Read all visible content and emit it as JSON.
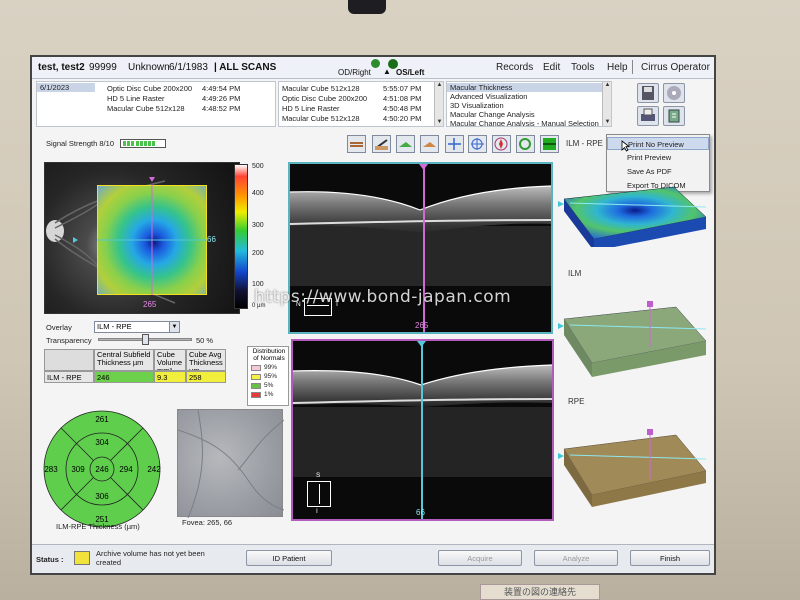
{
  "patient": {
    "name": "test, test2",
    "id": "99999",
    "sex": "Unknown",
    "dob": "6/1/1983",
    "mode": "| ALL SCANS"
  },
  "eye_selector": {
    "od_label": "OD/Right",
    "os_label": "OS/Left",
    "od_color": "#2e8b2e",
    "os_color": "#1a6e1a"
  },
  "menu": {
    "records": "Records",
    "edit": "Edit",
    "tools": "Tools",
    "help": "Help",
    "operator": "Cirrus Operator"
  },
  "scan_list": {
    "date": "6/1/2023",
    "col1": [
      {
        "name": "Optic Disc Cube 200x200",
        "time": "4:49:54 PM"
      },
      {
        "name": "HD 5 Line Raster",
        "time": "4:49:26 PM"
      },
      {
        "name": "Macular Cube 512x128",
        "time": "4:48:52 PM"
      }
    ],
    "col2": [
      {
        "name": "Macular Cube 512x128",
        "time": "5:55:07 PM"
      },
      {
        "name": "Optic Disc Cube 200x200",
        "time": "4:51:08 PM"
      },
      {
        "name": "HD 5 Line Raster",
        "time": "4:50:48 PM"
      },
      {
        "name": "Macular Cube 512x128",
        "time": "4:50:20 PM"
      }
    ],
    "analyses": [
      "Macular Thickness",
      "Advanced Visualization",
      "3D Visualization",
      "Macular Change Analysis",
      "Macular Change Analysis - Manual Selection"
    ]
  },
  "signal": {
    "label": "Signal Strength",
    "value": "8/10",
    "level": 0.8
  },
  "icons": {
    "save": "save-icon",
    "disc": "cd-icon",
    "print": "printer-icon",
    "export": "export-icon",
    "tools": [
      "layer-tool-icon",
      "edit-tool-icon",
      "green-layer-icon",
      "orange-layer-icon",
      "crosshair-icon",
      "target-icon",
      "compass-icon",
      "refresh-icon",
      "gradient-icon"
    ]
  },
  "colorbar": {
    "labels": [
      "500",
      "400",
      "300",
      "200",
      "100",
      "0 µm"
    ]
  },
  "fundus": {
    "h_marker": "66",
    "v_marker": "265"
  },
  "bscan_top": {
    "label": "265",
    "n": "N",
    "t": "T"
  },
  "bscan_bot": {
    "label": "66",
    "s": "S",
    "i": "I"
  },
  "context_menu": {
    "items": [
      "Print No Preview",
      "Print Preview",
      "Save As PDF",
      "Export To DICOM"
    ],
    "highlight_index": 0
  },
  "right_panel": {
    "ilm_rpe": "ILM - RPE",
    "ilm": "ILM",
    "rpe": "RPE"
  },
  "overlay": {
    "label": "Overlay",
    "value": "ILM - RPE"
  },
  "transparency": {
    "label": "Transparency",
    "value": "50 %",
    "level": 0.5
  },
  "thickness_table": {
    "headers": [
      "Central Subfield Thickness µm",
      "Cube Volume mm³",
      "Cube Avg Thickness µm"
    ],
    "row_label": "ILM - RPE",
    "values": [
      "246",
      "9.3",
      "258"
    ],
    "value_colors": [
      "#6dd04b",
      "#f2ef3c",
      "#f2ef3c"
    ]
  },
  "normals": {
    "title": "Distribution of Normals",
    "items": [
      {
        "label": "99%",
        "color": "#f7c8d8"
      },
      {
        "label": "95%",
        "color": "#f5f04a"
      },
      {
        "label": "5%",
        "color": "#6cc04a"
      },
      {
        "label": "1%",
        "color": "#e43c3c"
      }
    ]
  },
  "etdrs": {
    "center": "246",
    "inner": {
      "top": "304",
      "right": "294",
      "bottom": "306",
      "left": "309"
    },
    "outer": {
      "top": "261",
      "right": "242",
      "bottom": "251",
      "left": "283"
    },
    "caption": "ILM-RPE Thickness (µm)",
    "fill": "#5fce4d"
  },
  "fovea": {
    "caption": "Fovea:  265, 66"
  },
  "status": {
    "label": "Status :",
    "message": "Archive volume has not yet been created",
    "id_patient": "ID Patient",
    "acquire": "Acquire",
    "analyze": "Analyze",
    "finish": "Finish"
  },
  "watermark": "https://www.bond-japan.com",
  "sticker": "装置の図の連絡先"
}
